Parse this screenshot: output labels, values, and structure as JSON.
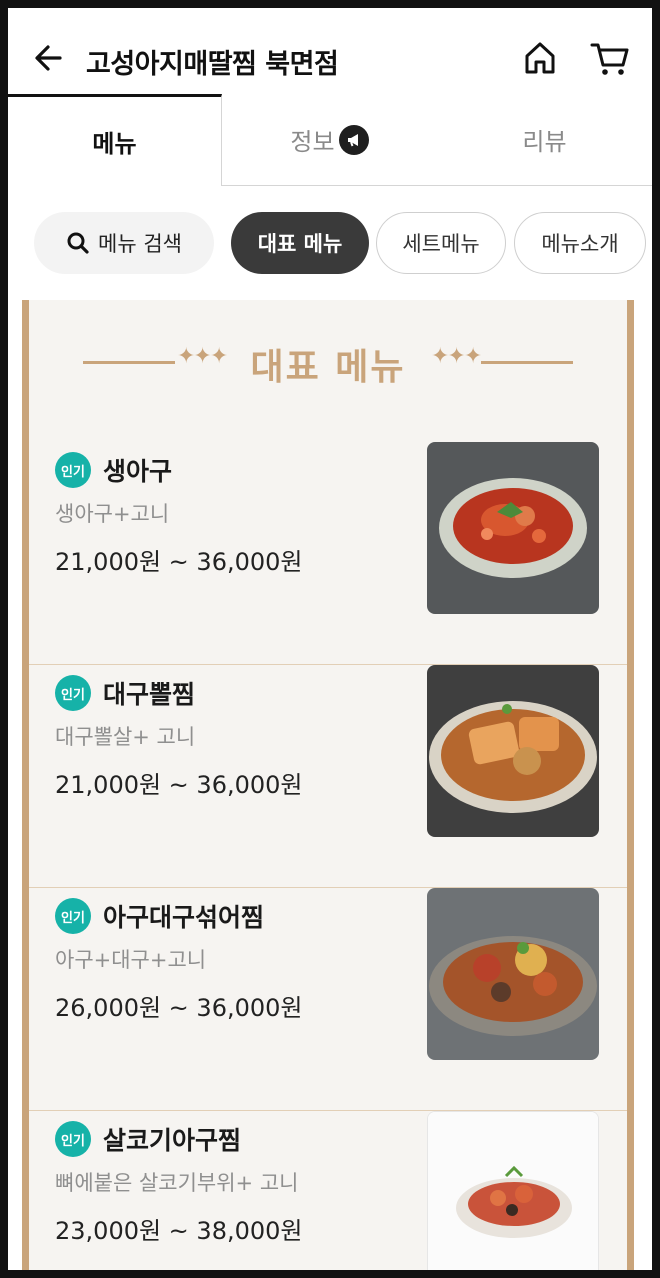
{
  "header": {
    "title": "고성아지매딸찜 북면점"
  },
  "tabs": [
    {
      "label": "메뉴"
    },
    {
      "label": "정보"
    },
    {
      "label": "리뷰"
    }
  ],
  "chips": {
    "search_label": "메뉴 검색",
    "rep_label": "대표 메뉴",
    "set_label": "세트메뉴",
    "intro_label": "메뉴소개"
  },
  "section": {
    "title": "대표 메뉴"
  },
  "badge_label": "인기",
  "items": [
    {
      "name": "생아구",
      "desc": "생아구+고니",
      "price": "21,000원 ~ 36,000원"
    },
    {
      "name": "대구뽈찜",
      "desc": "대구뽈살+ 고니",
      "price": "21,000원 ~ 36,000원"
    },
    {
      "name": "아구대구섞어찜",
      "desc": "아구+대구+고니",
      "price": "26,000원 ~ 36,000원"
    },
    {
      "name": "살코기아구찜",
      "desc": "뼈에붙은 살코기부위+ 고니",
      "price": "23,000원 ~ 38,000원"
    }
  ],
  "colors": {
    "accent_gold": "#c9a47b",
    "badge_teal": "#16b2a8",
    "chip_active": "#3a3a3a"
  }
}
